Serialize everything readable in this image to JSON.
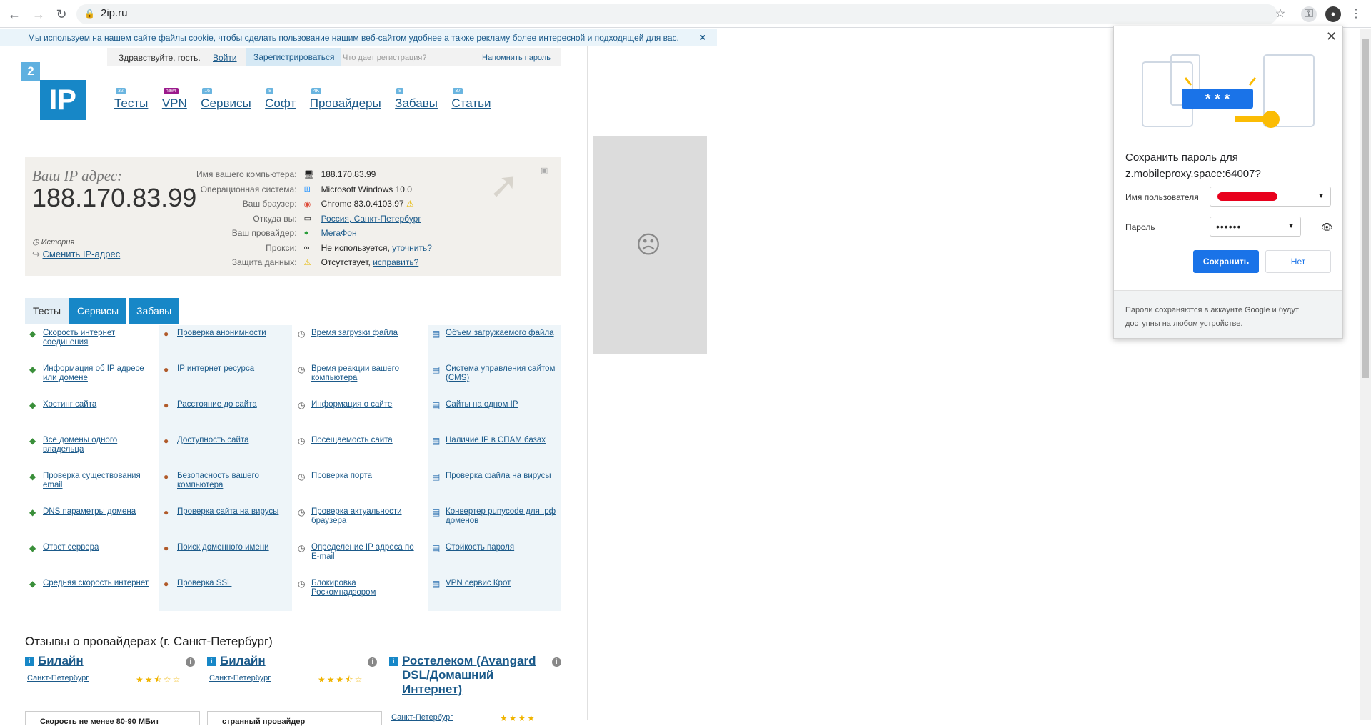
{
  "browser": {
    "url": "2ip.ru"
  },
  "cookie": {
    "text": "Мы используем на нашем сайте файлы cookie, чтобы сделать пользование нашим веб-сайтом удобнее а также рекламу более интересной и подходящей для вас.",
    "close": "×"
  },
  "userbar": {
    "greeting": "Здравствуйте, гость.",
    "login": "Войти",
    "register": "Зарегистрироваться",
    "why": "Что дает регистрация?",
    "remind": "Напомнить пароль"
  },
  "logo": {
    "small": "2",
    "big": "IP"
  },
  "mainnav": [
    {
      "label": "Тесты",
      "badge": "32"
    },
    {
      "label": "VPN",
      "badge": "new!"
    },
    {
      "label": "Сервисы",
      "badge": "16"
    },
    {
      "label": "Софт",
      "badge": "8"
    },
    {
      "label": "Провайдеры",
      "badge": "4K"
    },
    {
      "label": "Забавы",
      "badge": "8"
    },
    {
      "label": "Статьи",
      "badge": "37"
    }
  ],
  "ipbox": {
    "label": "Ваш IP адрес:",
    "ip": "188.170.83.99",
    "history": "История",
    "change": "Сменить IP-адрес",
    "rows": [
      {
        "key": "Имя вашего компьютера:",
        "value": "188.170.83.99",
        "link": ""
      },
      {
        "key": "Операционная система:",
        "value": "Microsoft Windows 10.0",
        "link": ""
      },
      {
        "key": "Ваш браузер:",
        "value": "Chrome 83.0.4103.97",
        "link": ""
      },
      {
        "key": "Откуда вы:",
        "value": "",
        "link": "Россия, Санкт-Петербург"
      },
      {
        "key": "Ваш провайдер:",
        "value": "",
        "link": "МегаФон"
      },
      {
        "key": "Прокси:",
        "value": "Не используется, ",
        "link": "уточнить?"
      },
      {
        "key": "Защита данных:",
        "value": "Отсутствует, ",
        "link": "исправить?"
      }
    ]
  },
  "tabs": [
    "Тесты",
    "Сервисы",
    "Забавы"
  ],
  "tests": [
    [
      "Скорость интернет соединения",
      "Проверка анонимности",
      "Время загрузки файла",
      "Объем загружаемого файла"
    ],
    [
      "Информация об IP адресе или домене",
      "IP интернет ресурса",
      "Время реакции вашего компьютера",
      "Система управления сайтом (CMS)"
    ],
    [
      "Хостинг сайта",
      "Расстояние до сайта",
      "Информация о сайте",
      "Сайты на одном IP"
    ],
    [
      "Все домены одного владельца",
      "Доступность сайта",
      "Посещаемость сайта",
      "Наличие IP в СПАМ базах"
    ],
    [
      "Проверка существования email",
      "Безопасность вашего компьютера",
      "Проверка порта",
      "Проверка файла на вирусы"
    ],
    [
      "DNS параметры домена",
      "Проверка сайта на вирусы",
      "Проверка актуальности браузера",
      "Конвертер punycode для .рф доменов"
    ],
    [
      "Ответ сервера",
      "Поиск доменного имени",
      "Определение IP адреса по E-mail",
      "Стойкость пароля"
    ],
    [
      "Средняя скорость интернет",
      "Проверка SSL",
      "Блокировка Роскомнадзором",
      "VPN сервис Крот"
    ]
  ],
  "reviews": {
    "title": "Отзывы о провайдерах (г. Санкт-Петербург)",
    "items": [
      {
        "name": "Билайн",
        "city": "Санкт-Петербург",
        "stars": 2.5,
        "quote": "Скорость не менее 80-90 МБит"
      },
      {
        "name": "Билайн",
        "city": "Санкт-Петербург",
        "stars": 3.5,
        "quote": "странный провайдер"
      },
      {
        "name": "Ростелеком (Avangard DSL/Домашний Интернет)",
        "city": "Санкт-Петербург",
        "stars": 4,
        "quote": ""
      }
    ]
  },
  "password_popup": {
    "title": "Сохранить пароль для z.mobileproxy.space:64007?",
    "username_label": "Имя пользователя",
    "password_label": "Пароль",
    "password_value": "••••••",
    "save": "Сохранить",
    "no": "Нет",
    "footer": "Пароли сохраняются в аккаунте Google и будут доступны на любом устройстве.",
    "illustration_text": "* * *"
  },
  "colors": {
    "accent": "#1787c7",
    "link": "#1b5a8a",
    "chrome_blue": "#1a73e8"
  }
}
